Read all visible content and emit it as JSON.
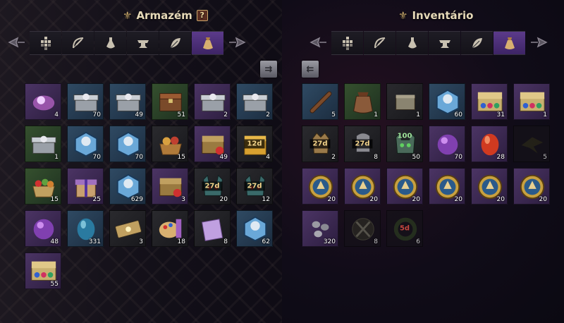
{
  "storage": {
    "title": "Armazém",
    "help_label": "?",
    "sort_label": "⇉",
    "items": [
      {
        "icon": "magic-scroll-icon",
        "rarity": "purple",
        "count": "4"
      },
      {
        "icon": "silver-box-icon",
        "rarity": "blue",
        "count": "70"
      },
      {
        "icon": "silver-box-icon",
        "rarity": "blue",
        "count": "49"
      },
      {
        "icon": "wooden-chest-icon",
        "rarity": "green",
        "count": "51"
      },
      {
        "icon": "silver-box-icon",
        "rarity": "purple",
        "count": "2"
      },
      {
        "icon": "silver-box-icon",
        "rarity": "blue",
        "count": "2"
      },
      {
        "icon": "silver-box-icon",
        "rarity": "green",
        "count": "1"
      },
      {
        "icon": "blue-hexagon-box-icon",
        "rarity": "blue",
        "count": "70"
      },
      {
        "icon": "blue-hexagon-box-icon",
        "rarity": "blue",
        "count": "70"
      },
      {
        "icon": "food-basket-icon",
        "rarity": "dark",
        "count": "15"
      },
      {
        "icon": "treasure-chest-icon",
        "rarity": "purple",
        "count": "49"
      },
      {
        "icon": "gold-chest-icon",
        "rarity": "dark",
        "count": "4",
        "timer": "12d"
      },
      {
        "icon": "fruit-basket-icon",
        "rarity": "green",
        "count": "15"
      },
      {
        "icon": "gift-box-icon",
        "rarity": "purple",
        "count": "25"
      },
      {
        "icon": "blue-hexagon-box-icon",
        "rarity": "blue",
        "count": "629"
      },
      {
        "icon": "treasure-chest-icon",
        "rarity": "purple",
        "count": "3"
      },
      {
        "icon": "demon-helmet-icon",
        "rarity": "dark",
        "count": "20",
        "timer": "27d"
      },
      {
        "icon": "demon-helmet-icon",
        "rarity": "dark",
        "count": "12",
        "timer": "27d"
      },
      {
        "icon": "purple-orb-icon",
        "rarity": "purple",
        "count": "48"
      },
      {
        "icon": "blue-egg-icon",
        "rarity": "blue",
        "count": "331"
      },
      {
        "icon": "gold-ticket-icon",
        "rarity": "dark",
        "count": "3"
      },
      {
        "icon": "paint-palette-icon",
        "rarity": "dark",
        "count": "18"
      },
      {
        "icon": "scroll-card-icon",
        "rarity": "dark",
        "count": "8"
      },
      {
        "icon": "blue-hexagon-box-icon",
        "rarity": "blue",
        "count": "62"
      },
      {
        "icon": "gem-chest-icon",
        "rarity": "purple",
        "count": "55"
      }
    ]
  },
  "inventory": {
    "title": "Inventário",
    "sort_label": "⇇",
    "items": [
      {
        "icon": "wooden-staff-icon",
        "rarity": "blue",
        "count": "5"
      },
      {
        "icon": "leather-pouch-icon",
        "rarity": "green",
        "count": "1"
      },
      {
        "icon": "small-crate-icon",
        "rarity": "dark",
        "count": "1"
      },
      {
        "icon": "blue-hexagon-box-icon",
        "rarity": "blue",
        "count": "60"
      },
      {
        "icon": "gem-chest-icon",
        "rarity": "purple",
        "count": "31"
      },
      {
        "icon": "gem-chest-icon",
        "rarity": "purple",
        "count": "1"
      },
      {
        "icon": "crowned-helmet-icon",
        "rarity": "dark",
        "count": "2",
        "timer": "27d"
      },
      {
        "icon": "knight-helmet-icon",
        "rarity": "dark",
        "count": "8",
        "timer": "27d"
      },
      {
        "icon": "skull-mask-icon",
        "rarity": "dark",
        "count": "50",
        "timer": "100",
        "timer_style": "green"
      },
      {
        "icon": "purple-orb-icon",
        "rarity": "purple",
        "count": "70"
      },
      {
        "icon": "red-egg-icon",
        "rarity": "purple",
        "count": "28"
      },
      {
        "icon": "shadow-bird-icon",
        "rarity": "empty",
        "count": "5"
      },
      {
        "icon": "gold-medal-icon",
        "rarity": "purple",
        "count": "20"
      },
      {
        "icon": "gold-medal-icon",
        "rarity": "purple",
        "count": "20"
      },
      {
        "icon": "gold-medal-icon",
        "rarity": "purple",
        "count": "20"
      },
      {
        "icon": "gold-medal-icon",
        "rarity": "purple",
        "count": "20"
      },
      {
        "icon": "gold-medal-icon",
        "rarity": "purple",
        "count": "20"
      },
      {
        "icon": "gold-medal-icon",
        "rarity": "purple",
        "count": "20"
      },
      {
        "icon": "stone-pebbles-icon",
        "rarity": "purple",
        "count": "320"
      },
      {
        "icon": "crossed-swords-icon",
        "rarity": "empty",
        "count": "8"
      },
      {
        "icon": "wreath-icon",
        "rarity": "empty",
        "count": "6",
        "timer": "5d",
        "timer_style": "red"
      }
    ]
  },
  "tabs": [
    {
      "icon": "all-items-icon",
      "active": false
    },
    {
      "icon": "bow-icon",
      "active": false
    },
    {
      "icon": "potion-icon",
      "active": false
    },
    {
      "icon": "anvil-icon",
      "active": false
    },
    {
      "icon": "leaf-icon",
      "active": false
    },
    {
      "icon": "bag-icon",
      "active": true
    }
  ],
  "colors": {
    "rarity_purple": "#4b3464",
    "rarity_blue": "#2f4a63",
    "rarity_green": "#35502e",
    "tab_active": "#5b3a8a",
    "timer_gold": "#f2d38a",
    "title": "#e6d9b8"
  }
}
